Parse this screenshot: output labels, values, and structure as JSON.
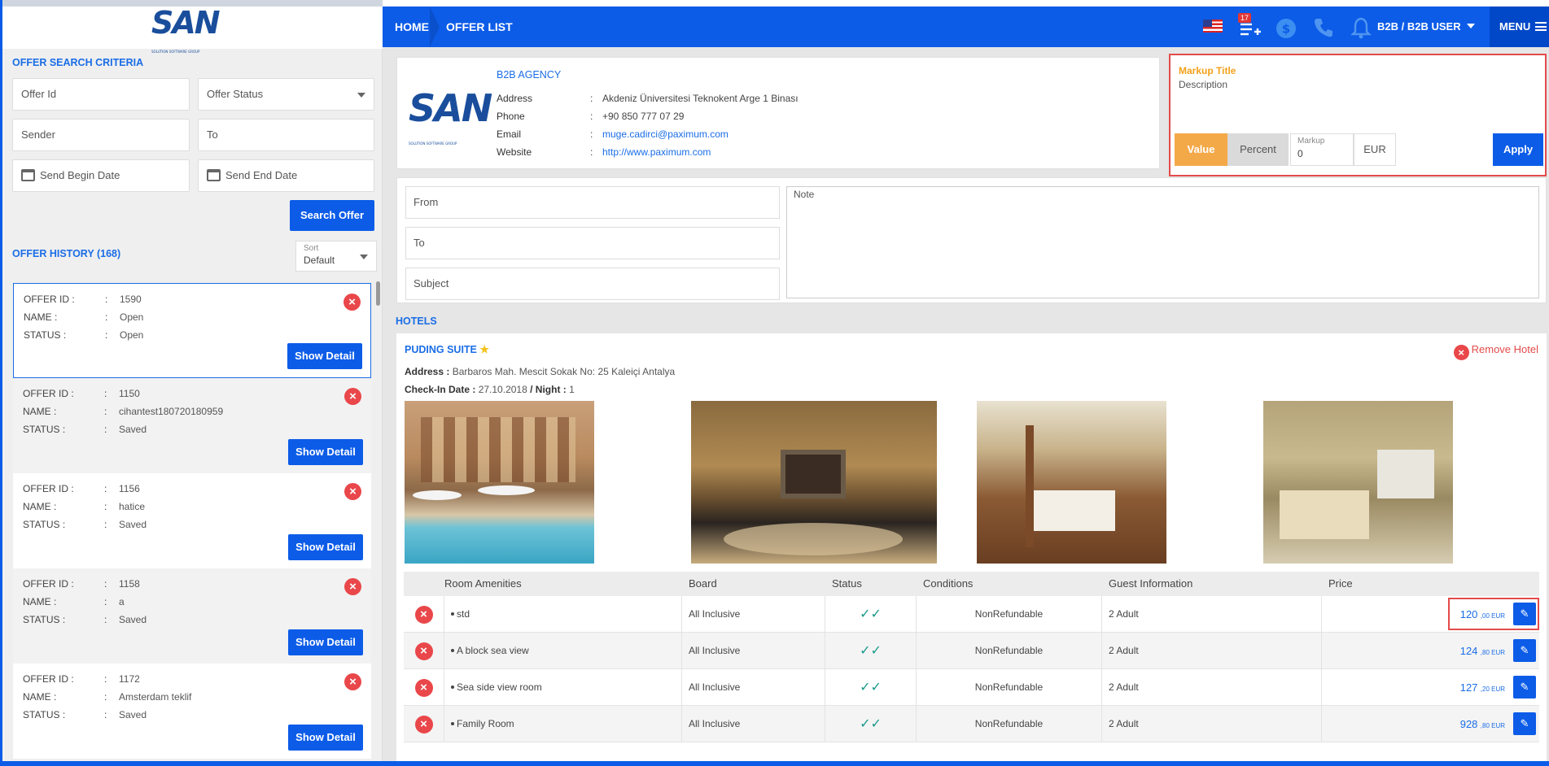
{
  "brand": {
    "logo_text": "SAN",
    "logo_sub": "SOLUTION SOFTWARE GROUP"
  },
  "search": {
    "title": "OFFER SEARCH CRITERIA",
    "offer_id_placeholder": "Offer Id",
    "offer_status_placeholder": "Offer Status",
    "sender_placeholder": "Sender",
    "to_placeholder": "To",
    "begin_date_placeholder": "Send Begin Date",
    "end_date_placeholder": "Send End Date",
    "search_button": "Search Offer"
  },
  "history": {
    "title": "OFFER HISTORY (168)",
    "sort_label": "Sort",
    "sort_value": "Default",
    "labels": {
      "offer_id": "OFFER ID :",
      "name": "NAME :",
      "status": "STATUS :",
      "sep": ":"
    },
    "show_detail": "Show Detail",
    "items": [
      {
        "offer_id": "1590",
        "name": "Open",
        "status": "Open"
      },
      {
        "offer_id": "1150",
        "name": "cihantest180720180959",
        "status": "Saved"
      },
      {
        "offer_id": "1156",
        "name": "hatice",
        "status": "Saved"
      },
      {
        "offer_id": "1158",
        "name": "a",
        "status": "Saved"
      },
      {
        "offer_id": "1172",
        "name": "Amsterdam teklif",
        "status": "Saved"
      }
    ]
  },
  "header": {
    "home": "HOME",
    "current": "OFFER LIST",
    "cart_badge": "17",
    "user": "B2B / B2B USER",
    "menu": "MENU"
  },
  "agency": {
    "name": "B2B AGENCY",
    "address_label": "Address",
    "address": "Akdeniz Üniversitesi Teknokent Arge 1 Binası",
    "phone_label": "Phone",
    "phone": "+90 850 777 07 29",
    "email_label": "Email",
    "email": "muge.cadirci@paximum.com",
    "website_label": "Website",
    "website": "http://www.paximum.com",
    "sep": ":"
  },
  "markup": {
    "title": "Markup Title",
    "description": "Description",
    "value_btn": "Value",
    "percent_btn": "Percent",
    "markup_label": "Markup",
    "markup_value": "0",
    "currency": "EUR",
    "apply_btn": "Apply"
  },
  "mail": {
    "from_placeholder": "From",
    "to_placeholder": "To",
    "subject_placeholder": "Subject",
    "note_placeholder": "Note"
  },
  "hotels": {
    "section_title": "HOTELS",
    "hotel_name": "PUDING SUITE",
    "remove_label": "Remove Hotel",
    "address_label": "Address :",
    "address": "Barbaros Mah. Mescit Sokak No: 25 Kaleiçi Antalya",
    "checkin_label": "Check-In Date :",
    "checkin": "27.10.2018",
    "night_label": "/ Night :",
    "night": "1",
    "table_headers": {
      "amenities": "Room Amenities",
      "board": "Board",
      "status": "Status",
      "conditions": "Conditions",
      "guest": "Guest Information",
      "price": "Price"
    },
    "rooms": [
      {
        "name": "std",
        "board": "All Inclusive",
        "conditions": "NonRefundable",
        "guest": "2 Adult",
        "price_int": "120",
        "price_dec": ",00 EUR"
      },
      {
        "name": "A block sea view",
        "board": "All Inclusive",
        "conditions": "NonRefundable",
        "guest": "2 Adult",
        "price_int": "124",
        "price_dec": ",80 EUR"
      },
      {
        "name": "Sea side view room",
        "board": "All Inclusive",
        "conditions": "NonRefundable",
        "guest": "2 Adult",
        "price_int": "127",
        "price_dec": ",20 EUR"
      },
      {
        "name": "Family Room",
        "board": "All Inclusive",
        "conditions": "NonRefundable",
        "guest": "2 Adult",
        "price_int": "928",
        "price_dec": ",80 EUR"
      }
    ]
  },
  "colors": {
    "primary": "#0c5ce8",
    "accent": "#f4a11c",
    "danger": "#e9474a",
    "status_ok": "#1a9a8a"
  }
}
